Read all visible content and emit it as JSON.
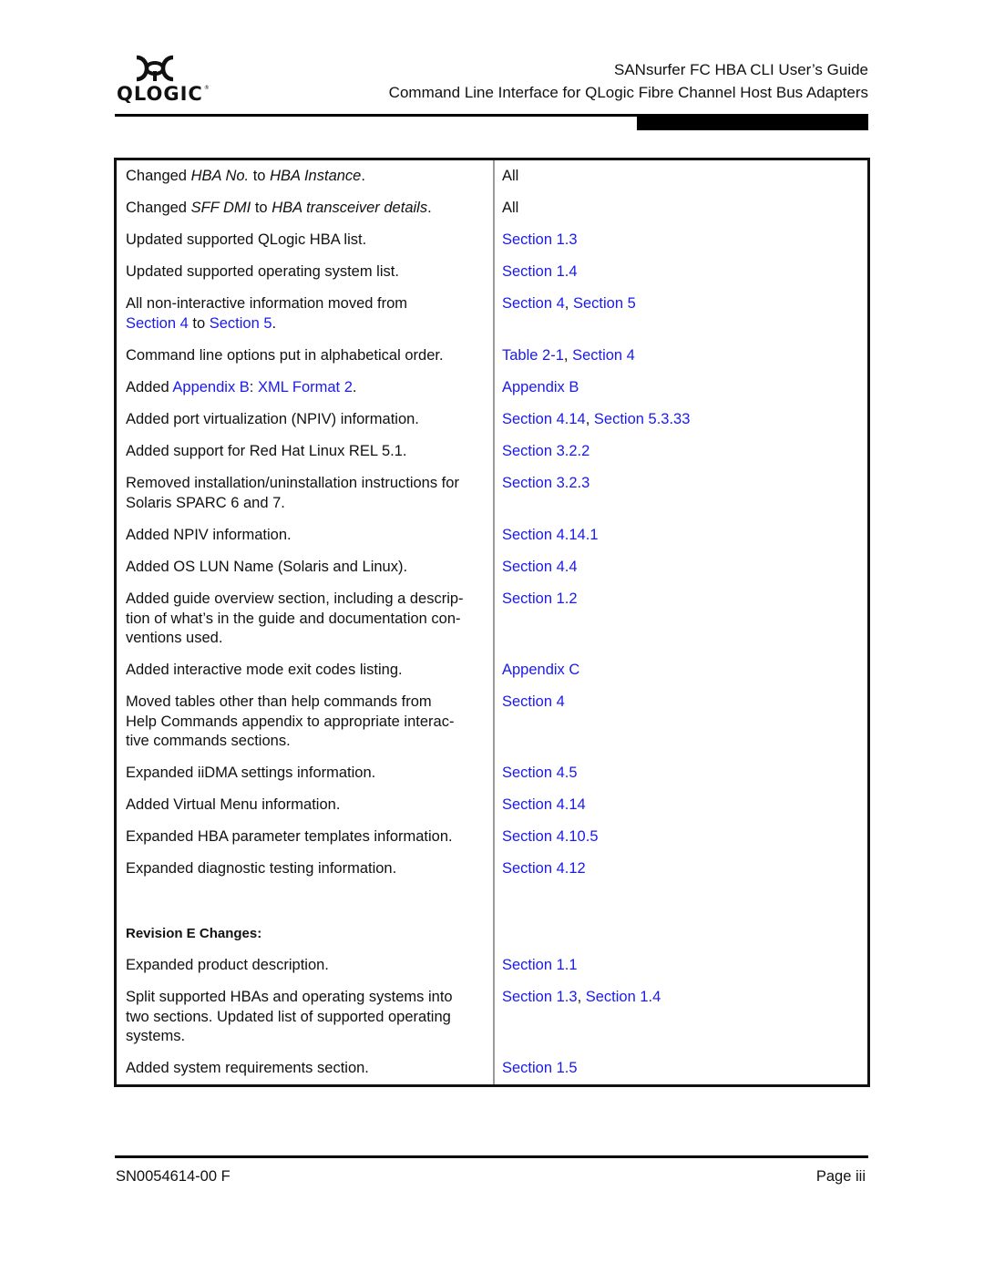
{
  "header": {
    "logo_text": "QLOGIC",
    "logo_reg": "®",
    "title": "SANsurfer FC HBA CLI User’s Guide",
    "subtitle": "Command Line Interface for QLogic Fibre Channel Host Bus Adapters"
  },
  "colors": {
    "link": "#1a1aee",
    "text": "#111111",
    "rule": "#000000",
    "divider": "#9a9a9a"
  },
  "rows": [
    {
      "c1": [
        {
          "t": "Changed "
        },
        {
          "t": "HBA No.",
          "i": true
        },
        {
          "t": " to "
        },
        {
          "t": "HBA Instance",
          "i": true
        },
        {
          "t": "."
        }
      ],
      "c2": [
        {
          "t": "All"
        }
      ]
    },
    {
      "c1": [
        {
          "t": "Changed "
        },
        {
          "t": "SFF DMI",
          "i": true
        },
        {
          "t": " to "
        },
        {
          "t": "HBA transceiver details",
          "i": true
        },
        {
          "t": "."
        }
      ],
      "c2": [
        {
          "t": "All"
        }
      ]
    },
    {
      "c1": [
        {
          "t": "Updated supported QLogic HBA list."
        }
      ],
      "c2": [
        {
          "t": "Section 1.3",
          "l": true
        }
      ]
    },
    {
      "c1": [
        {
          "t": "Updated supported operating system list."
        }
      ],
      "c2": [
        {
          "t": "Section 1.4",
          "l": true
        }
      ]
    },
    {
      "c1": [
        {
          "t": "All non-interactive information moved from "
        },
        {
          "br": true
        },
        {
          "t": "Section 4",
          "l": true
        },
        {
          "t": " to "
        },
        {
          "t": "Section 5",
          "l": true
        },
        {
          "t": "."
        }
      ],
      "c2": [
        {
          "t": "Section 4",
          "l": true
        },
        {
          "t": ", "
        },
        {
          "t": "Section 5",
          "l": true
        }
      ]
    },
    {
      "c1": [
        {
          "t": "Command line options put in alphabetical order."
        }
      ],
      "c2": [
        {
          "t": "Table 2-1",
          "l": true
        },
        {
          "t": ", "
        },
        {
          "t": "Section 4",
          "l": true
        }
      ]
    },
    {
      "c1": [
        {
          "t": "Added "
        },
        {
          "t": "Appendix B",
          "l": true
        },
        {
          "t": ": "
        },
        {
          "t": "XML Format 2",
          "l": true
        },
        {
          "t": "."
        }
      ],
      "c2": [
        {
          "t": "Appendix B",
          "l": true
        }
      ]
    },
    {
      "c1": [
        {
          "t": "Added port virtualization (NPIV) information."
        }
      ],
      "c2": [
        {
          "t": "Section 4.14",
          "l": true
        },
        {
          "t": ", "
        },
        {
          "t": "Section 5.3.33",
          "l": true
        }
      ]
    },
    {
      "c1": [
        {
          "t": "Added support for Red Hat Linux REL 5.1."
        }
      ],
      "c2": [
        {
          "t": "Section 3.2.2",
          "l": true
        }
      ]
    },
    {
      "c1": [
        {
          "t": "Removed installation/uninstallation instructions for "
        },
        {
          "br": true
        },
        {
          "t": "Solaris SPARC 6 and 7."
        }
      ],
      "c2": [
        {
          "t": "Section 3.2.3",
          "l": true
        }
      ]
    },
    {
      "c1": [
        {
          "t": "Added NPIV information."
        }
      ],
      "c2": [
        {
          "t": "Section 4.14.1",
          "l": true
        }
      ]
    },
    {
      "c1": [
        {
          "t": "Added OS LUN Name (Solaris and Linux)."
        }
      ],
      "c2": [
        {
          "t": "Section 4.4",
          "l": true
        }
      ]
    },
    {
      "c1": [
        {
          "t": "Added guide overview section, including a descrip-"
        },
        {
          "br": true
        },
        {
          "t": "tion of what’s in the guide and documentation con-"
        },
        {
          "br": true
        },
        {
          "t": "ventions used."
        }
      ],
      "c2": [
        {
          "t": "Section 1.2",
          "l": true
        }
      ]
    },
    {
      "c1": [
        {
          "t": "Added interactive mode exit codes listing."
        }
      ],
      "c2": [
        {
          "t": "Appendix C",
          "l": true
        }
      ]
    },
    {
      "c1": [
        {
          "t": "Moved tables other than help commands from "
        },
        {
          "br": true
        },
        {
          "t": "Help Commands appendix to appropriate interac-"
        },
        {
          "br": true
        },
        {
          "t": "tive commands sections."
        }
      ],
      "c2": [
        {
          "t": "Section 4",
          "l": true
        }
      ]
    },
    {
      "c1": [
        {
          "t": "Expanded iiDMA settings information."
        }
      ],
      "c2": [
        {
          "t": "Section 4.5",
          "l": true
        }
      ]
    },
    {
      "c1": [
        {
          "t": "Added Virtual Menu information."
        }
      ],
      "c2": [
        {
          "t": "Section 4.14",
          "l": true
        }
      ]
    },
    {
      "c1": [
        {
          "t": "Expanded HBA parameter templates information."
        }
      ],
      "c2": [
        {
          "t": "Section 4.10.5",
          "l": true
        }
      ]
    },
    {
      "c1": [
        {
          "t": "Expanded diagnostic testing information."
        }
      ],
      "c2": [
        {
          "t": "Section 4.12",
          "l": true
        }
      ]
    },
    {
      "c1": [
        {
          "t": "Revision E Changes:",
          "b": true
        }
      ],
      "c2": []
    },
    {
      "c1": [
        {
          "t": "Expanded product description."
        }
      ],
      "c2": [
        {
          "t": "Section 1.1",
          "l": true
        }
      ]
    },
    {
      "c1": [
        {
          "t": "Split supported HBAs and operating systems into "
        },
        {
          "br": true
        },
        {
          "t": "two sections. Updated list of supported operating "
        },
        {
          "br": true
        },
        {
          "t": "systems."
        }
      ],
      "c2": [
        {
          "t": "Section 1.3",
          "l": true
        },
        {
          "t": ", "
        },
        {
          "t": "Section 1.4",
          "l": true
        }
      ]
    },
    {
      "c1": [
        {
          "t": "Added system requirements section."
        }
      ],
      "c2": [
        {
          "t": "Section 1.5",
          "l": true
        }
      ]
    }
  ],
  "footer": {
    "doc_number": "SN0054614-00  F",
    "page": "Page iii"
  }
}
